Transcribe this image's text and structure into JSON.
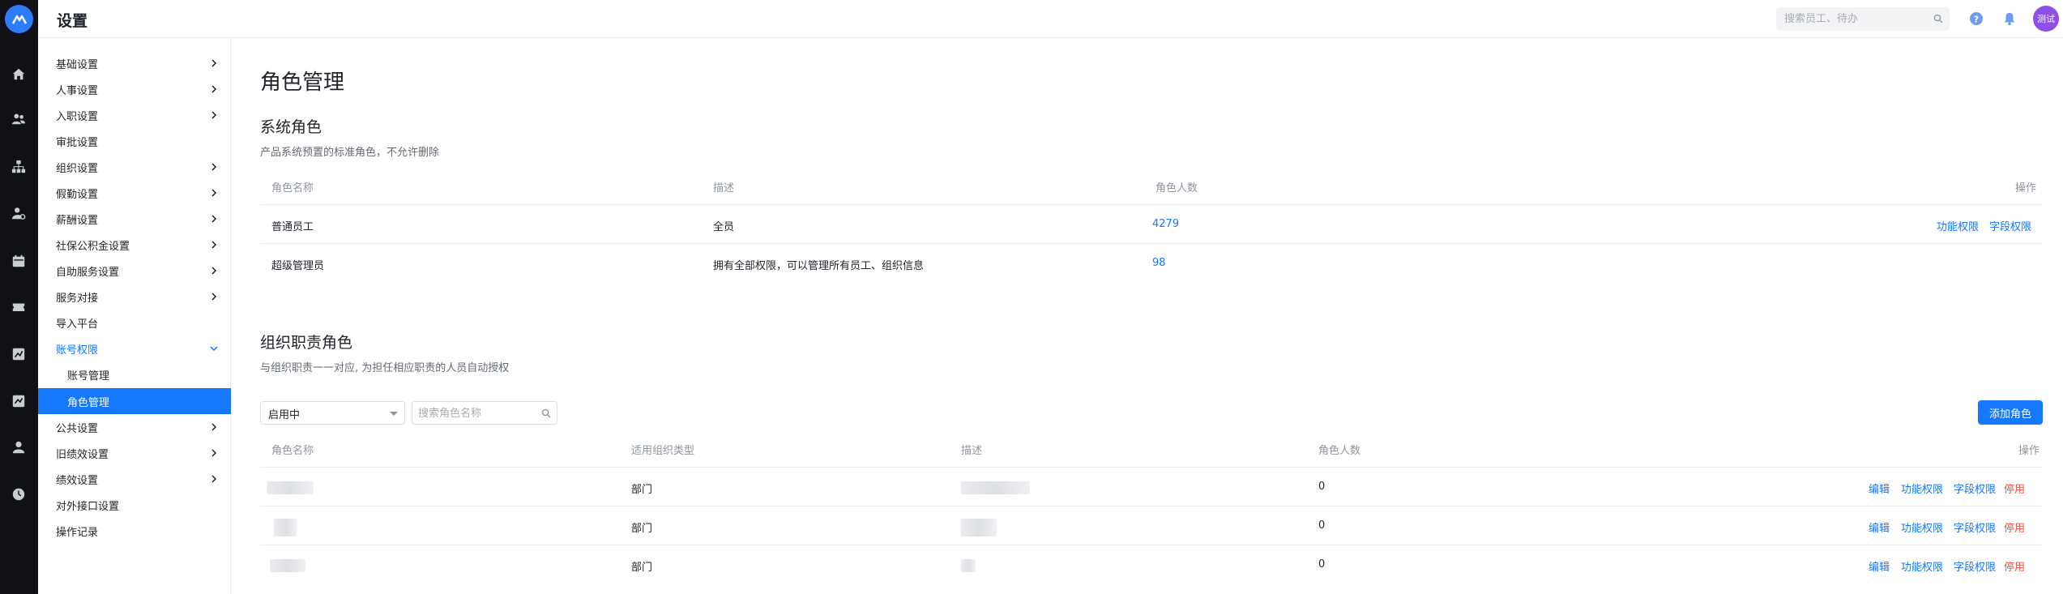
{
  "header": {
    "title": "设置",
    "search_placeholder": "搜索员工、待办",
    "avatar_text": "测试"
  },
  "rail": {
    "icons": [
      "logo-icon",
      "home-icon",
      "people-icon",
      "org-tree-icon",
      "user-settings-icon",
      "calendar-icon",
      "ticket-icon",
      "chart-icon",
      "report-icon",
      "person-icon",
      "clock-icon"
    ]
  },
  "sidebar": {
    "items": [
      {
        "label": "基础设置",
        "chevron": "right"
      },
      {
        "label": "人事设置",
        "chevron": "right"
      },
      {
        "label": "入职设置",
        "chevron": "right"
      },
      {
        "label": "审批设置",
        "chevron": ""
      },
      {
        "label": "组织设置",
        "chevron": "right"
      },
      {
        "label": "假勤设置",
        "chevron": "right"
      },
      {
        "label": "薪酬设置",
        "chevron": "right"
      },
      {
        "label": "社保公积金设置",
        "chevron": "right"
      },
      {
        "label": "自助服务设置",
        "chevron": "right"
      },
      {
        "label": "服务对接",
        "chevron": "right"
      },
      {
        "label": "导入平台",
        "chevron": ""
      },
      {
        "label": "账号权限",
        "chevron": "down"
      },
      {
        "label": "账号管理",
        "chevron": ""
      },
      {
        "label": "角色管理",
        "chevron": ""
      },
      {
        "label": "公共设置",
        "chevron": "right"
      },
      {
        "label": "旧绩效设置",
        "chevron": "right"
      },
      {
        "label": "绩效设置",
        "chevron": "right"
      },
      {
        "label": "对外接口设置",
        "chevron": ""
      },
      {
        "label": "操作记录",
        "chevron": ""
      }
    ],
    "active": "角色管理",
    "open": "账号权限"
  },
  "main": {
    "page_title": "角色管理",
    "system_roles": {
      "title": "系统角色",
      "desc": "产品系统预置的标准角色，不允许删除",
      "columns": [
        "角色名称",
        "描述",
        "角色人数",
        "操作"
      ],
      "rows": [
        {
          "name": "普通员工",
          "desc": "全员",
          "count": "4279",
          "actions": [
            "功能权限",
            "字段权限"
          ]
        },
        {
          "name": "超级管理员",
          "desc": "拥有全部权限，可以管理所有员工、组织信息",
          "count": "98",
          "actions": []
        }
      ]
    },
    "org_roles": {
      "title": "组织职责角色",
      "desc": "与组织职责一一对应, 为担任相应职责的人员自动授权",
      "filter_value": "启用中",
      "search_placeholder": "搜索角色名称",
      "add_button": "添加角色",
      "columns": [
        "角色名称",
        "适用组织类型",
        "描述",
        "角色人数",
        "操作"
      ],
      "rows": [
        {
          "org_type": "部门",
          "count": "0",
          "actions": [
            "编辑",
            "功能权限",
            "字段权限",
            "停用"
          ]
        },
        {
          "org_type": "部门",
          "count": "0",
          "actions": [
            "编辑",
            "功能权限",
            "字段权限",
            "停用"
          ]
        },
        {
          "org_type": "部门",
          "count": "0",
          "actions": [
            "编辑",
            "功能权限",
            "字段权限",
            "停用"
          ]
        }
      ]
    }
  },
  "colors": {
    "accent": "#1677ff",
    "danger": "#f5534a",
    "rail_bg": "#0f1116",
    "avatar_bg": "#8e4fe8"
  }
}
